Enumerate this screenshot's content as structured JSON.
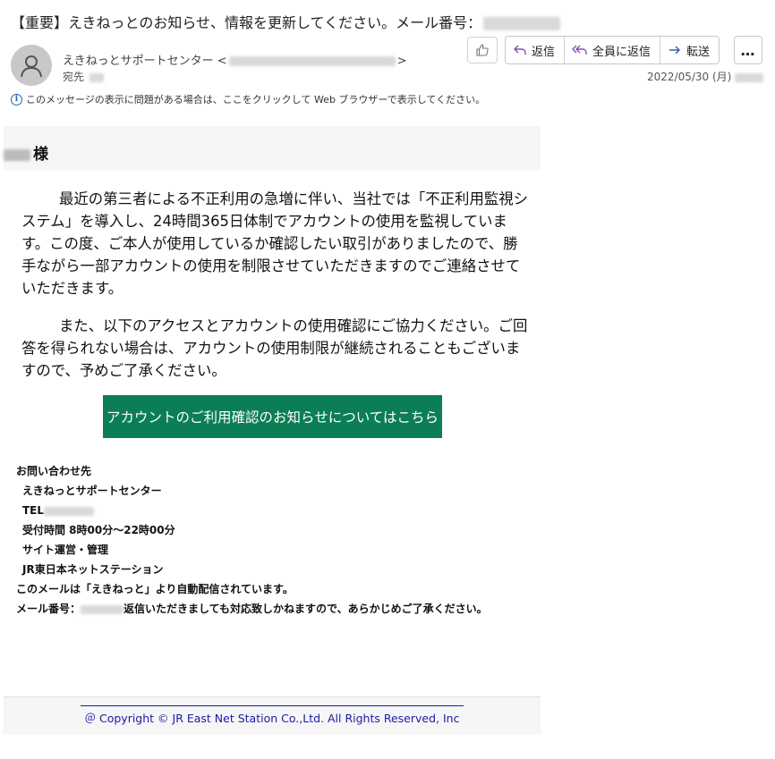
{
  "subject": "【重要】えきねっとのお知らせ、情報を更新してください。メール番号：",
  "sender": {
    "name": "えきねっとサポートセンター",
    "open_bracket": "<",
    "close_bracket": ">",
    "to_label": "宛先"
  },
  "toolbar": {
    "reply": "返信",
    "reply_all": "全員に返信",
    "forward": "転送",
    "more": "…"
  },
  "date": "2022/05/30 (月)",
  "info_notice": "このメッセージの表示に問題がある場合は、ここをクリックして Web ブラウザーで表示してください。",
  "body": {
    "salutation": "様",
    "paragraph1": "最近の第三者による不正利用の急増に伴い、当社では「不正利用監視システム」を導入し、24時間365日体制でアカウントの使用を監視しています。この度、ご本人が使用しているか確認したい取引がありましたので、勝手ながら一部アカウントの使用を制限させていただきますのでご連絡させていただきます。",
    "paragraph2": "また、以下のアクセスとアカウントの使用確認にご協力ください。ご回答を得られない場合は、アカウントの使用制限が継続されることもございますので、予めご了承ください。",
    "cta_button": "アカウントのご利用確認のお知らせについてはこちら"
  },
  "contact": {
    "heading": "お問い合わせ先",
    "center": "えきねっとサポートセンター",
    "tel_label": "TEL",
    "hours": "受付時間 8時00分～22時00分",
    "operation": "サイト運営・管理",
    "company": "JR東日本ネットステーション",
    "auto_notice": "このメールは「えきねっと」より自動配信されています。",
    "mail_no_label": "メール番号：",
    "mail_no_suffix": "返信いただきましても対応致しかねますので、あらかじめご了承ください。"
  },
  "footer": {
    "copyright": "＠ Copyright © JR East Net Station Co.,Ltd. All Rights Reserved, Inc"
  },
  "colors": {
    "cta_green": "#0c7e55",
    "footer_link": "#1a1aa8",
    "info_blue": "#2a64b4"
  }
}
